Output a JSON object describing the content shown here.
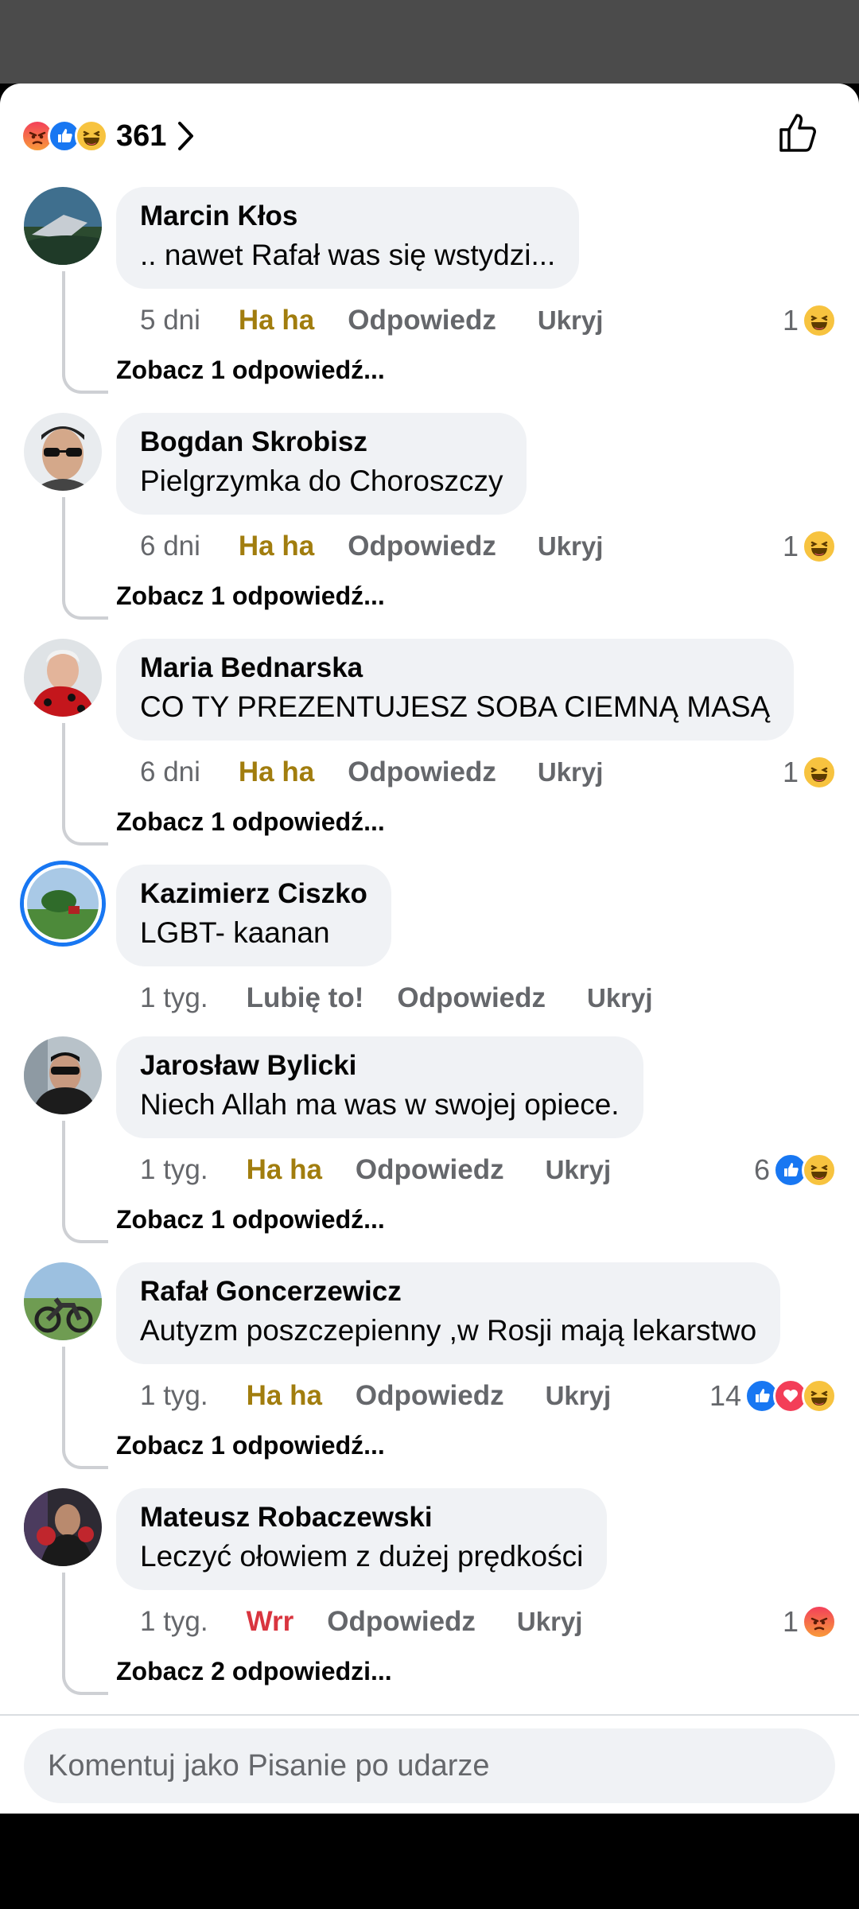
{
  "reactions_summary": {
    "icons": [
      "angry",
      "like",
      "haha"
    ],
    "count": "361"
  },
  "comments": [
    {
      "author": "Marcin Kłos",
      "text": ".. nawet Rafał was się wstydzi...",
      "time": "5 dni",
      "reaction_label": "Ha ha",
      "reply_label": "Odpowiedz",
      "hide_label": "Ukryj",
      "reaction_count": "1",
      "reaction_icons": [
        "haha"
      ],
      "see_replies": "Zobacz 1 odpowiedź..."
    },
    {
      "author": "Bogdan Skrobisz",
      "text": "Pielgrzymka do Choroszczy",
      "time": "6 dni",
      "reaction_label": "Ha ha",
      "reply_label": "Odpowiedz",
      "hide_label": "Ukryj",
      "reaction_count": "1",
      "reaction_icons": [
        "haha"
      ],
      "see_replies": "Zobacz 1 odpowiedź..."
    },
    {
      "author": "Maria Bednarska",
      "text": "CO TY PREZENTUJESZ SOBA CIEMNĄ MASĄ",
      "time": "6 dni",
      "reaction_label": "Ha ha",
      "reply_label": "Odpowiedz",
      "hide_label": "Ukryj",
      "reaction_count": "1",
      "reaction_icons": [
        "haha"
      ],
      "see_replies": "Zobacz 1 odpowiedź..."
    },
    {
      "author": "Kazimierz Ciszko",
      "text": "LGBT- kaanan",
      "time": "1 tyg.",
      "reaction_label": "Lubię to!",
      "reply_label": "Odpowiedz",
      "hide_label": "Ukryj"
    },
    {
      "author": "Jarosław Bylicki",
      "text": "Niech Allah ma was w swojej opiece.",
      "time": "1 tyg.",
      "reaction_label": "Ha ha",
      "reply_label": "Odpowiedz",
      "hide_label": "Ukryj",
      "reaction_count": "6",
      "reaction_icons": [
        "like",
        "haha"
      ],
      "see_replies": "Zobacz 1 odpowiedź..."
    },
    {
      "author": "Rafał Goncerzewicz",
      "text": "Autyzm poszczepienny ,w Rosji mają lekarstwo",
      "time": "1 tyg.",
      "reaction_label": "Ha ha",
      "reply_label": "Odpowiedz",
      "hide_label": "Ukryj",
      "reaction_count": "14",
      "reaction_icons": [
        "like",
        "love",
        "haha"
      ],
      "see_replies": "Zobacz 1 odpowiedź..."
    },
    {
      "author": "Mateusz Robaczewski",
      "text": "Leczyć ołowiem z dużej prędkości",
      "time": "1 tyg.",
      "reaction_label": "Wrr",
      "reply_label": "Odpowiedz",
      "hide_label": "Ukryj",
      "reaction_count": "1",
      "reaction_icons": [
        "angry"
      ],
      "see_replies": "Zobacz 2 odpowiedzi..."
    }
  ],
  "composer": {
    "placeholder": "Komentuj jako Pisanie po udarze"
  },
  "colors": {
    "haha": "#a17d0e",
    "wrr": "#d9353f",
    "like_blue": "#1877f2",
    "bubble": "#f0f2f5"
  }
}
